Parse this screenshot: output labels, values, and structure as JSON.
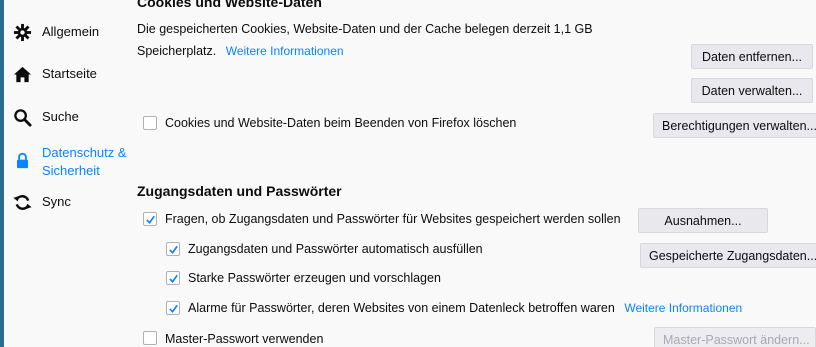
{
  "sidebar": {
    "items": [
      {
        "label": "Allgemein",
        "icon": "gear-icon"
      },
      {
        "label": "Startseite",
        "icon": "home-icon"
      },
      {
        "label": "Suche",
        "icon": "search-icon"
      },
      {
        "label": "Datenschutz &",
        "label2": "Sicherheit",
        "icon": "lock-icon",
        "active": true
      },
      {
        "label": "Sync",
        "icon": "sync-icon"
      }
    ]
  },
  "cookies": {
    "title": "Cookies und Website-Daten",
    "desc_line1": "Die gespeicherten Cookies, Website-Daten und der Cache belegen derzeit 1,1 GB",
    "desc_line2": "Speicherplatz.",
    "more_info": "Weitere Informationen",
    "clear_button": "Daten entfernen...",
    "manage_button": "Daten verwalten...",
    "delete_on_close_label": "Cookies und Website-Daten beim Beenden von Firefox löschen",
    "delete_on_close_checked": false,
    "permissions_button": "Berechtigungen verwalten..."
  },
  "logins": {
    "title": "Zugangsdaten und Passwörter",
    "ask_save_label": "Fragen, ob Zugangsdaten und Passwörter für Websites gespeichert werden sollen",
    "ask_save_checked": true,
    "exceptions_button": "Ausnahmen...",
    "autofill_label": "Zugangsdaten und Passwörter automatisch ausfüllen",
    "autofill_checked": true,
    "saved_logins_button": "Gespeicherte Zugangsdaten...",
    "generate_label": "Starke Passwörter erzeugen und vorschlagen",
    "generate_checked": true,
    "breach_label": "Alarme für Passwörter, deren Websites von einem Datenleck betroffen waren",
    "breach_checked": true,
    "breach_more_info": "Weitere Informationen",
    "master_label": "Master-Passwort verwenden",
    "master_checked": false,
    "master_button": "Master-Passwort ändern..."
  },
  "colors": {
    "accent": "#0a84ff",
    "background": "#f9f9fa",
    "outer": "#2a6c8f"
  }
}
